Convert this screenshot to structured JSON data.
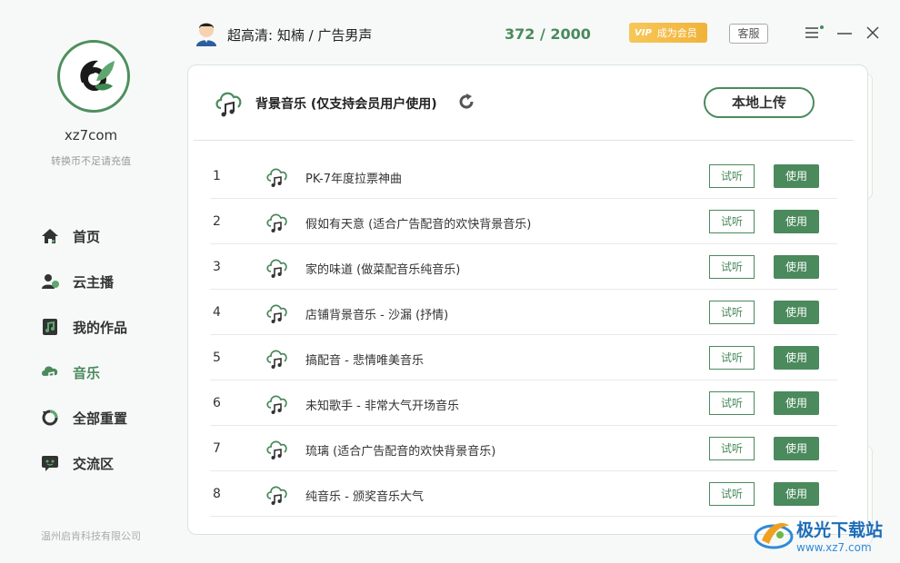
{
  "sidebar": {
    "username": "xz7com",
    "balance_note": "转换币不足请充值",
    "items": [
      {
        "label": "首页",
        "icon": "home-icon",
        "active": false
      },
      {
        "label": "云主播",
        "icon": "anchor-icon",
        "active": false
      },
      {
        "label": "我的作品",
        "icon": "works-icon",
        "active": false
      },
      {
        "label": "音乐",
        "icon": "music-cloud-icon",
        "active": true
      },
      {
        "label": "全部重置",
        "icon": "reset-icon",
        "active": false
      },
      {
        "label": "交流区",
        "icon": "chat-icon",
        "active": false
      }
    ],
    "company": "温州启肯科技有限公司"
  },
  "header": {
    "voice_label": "超高清: 知楠 / 广告男声",
    "quota": "372 / 2000",
    "vip_tag": "VIP",
    "vip_label": "成为会员",
    "service_label": "客服"
  },
  "panel": {
    "title": "背景音乐 (仅支持会员用户使用)",
    "upload_label": "本地上传",
    "listen_label": "试听",
    "use_label": "使用",
    "tracks": [
      {
        "index": "1",
        "name": "PK-7年度拉票神曲"
      },
      {
        "index": "2",
        "name": "假如有天意 (适合广告配音的欢快背景音乐)"
      },
      {
        "index": "3",
        "name": "家的味道 (做菜配音乐纯音乐)"
      },
      {
        "index": "4",
        "name": "店铺背景音乐 - 沙漏 (抒情)"
      },
      {
        "index": "5",
        "name": "搞配音 - 悲情唯美音乐"
      },
      {
        "index": "6",
        "name": "未知歌手 - 非常大气开场音乐"
      },
      {
        "index": "7",
        "name": "琉璃 (适合广告配音的欢快背景音乐)"
      },
      {
        "index": "8",
        "name": "纯音乐 - 颁奖音乐大气"
      }
    ]
  },
  "watermark": {
    "title": "极光下载站",
    "url": "www.xz7.com"
  },
  "colors": {
    "accent": "#4a8a5c",
    "vip": "#f0b33a",
    "watermark": "#1e6db8"
  }
}
